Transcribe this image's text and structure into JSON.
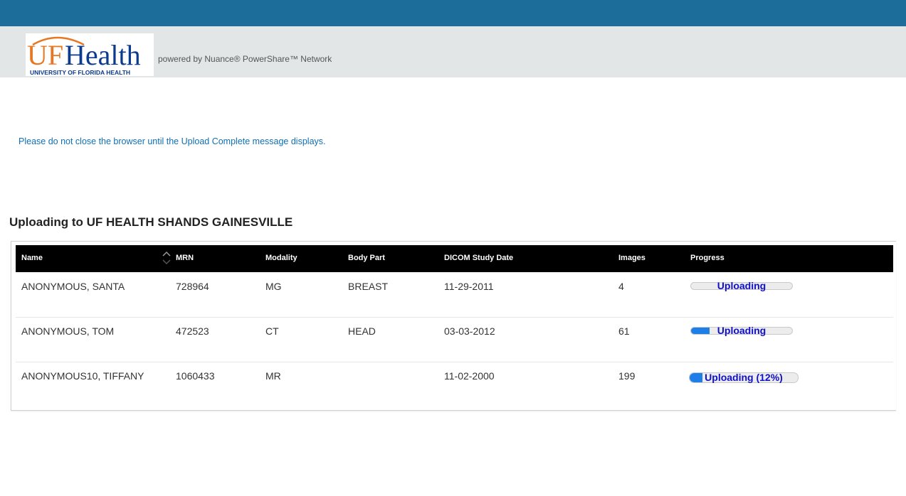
{
  "header": {
    "logo_text": "UFHealth",
    "logo_subtext": "UNIVERSITY OF FLORIDA HEALTH",
    "powered_by": "powered by Nuance® PowerShare™ Network"
  },
  "notice": "Please do not close the browser until the Upload Complete message displays.",
  "upload": {
    "prefix": "Uploading to ",
    "destination": "UF HEALTH SHANDS GAINESVILLE"
  },
  "table": {
    "columns": [
      "Name",
      "MRN",
      "Modality",
      "Body Part",
      "DICOM Study Date",
      "Images",
      "Progress"
    ],
    "rows": [
      {
        "name": "ANONYMOUS, SANTA",
        "mrn": "728964",
        "modality": "MG",
        "body_part": "BREAST",
        "date": "11-29-2011",
        "images": "4",
        "progress_label": "Uploading",
        "progress_fraction": 0.0
      },
      {
        "name": "ANONYMOUS, TOM",
        "mrn": "472523",
        "modality": "CT",
        "body_part": "HEAD",
        "date": "03-03-2012",
        "images": "61",
        "progress_label": "Uploading",
        "progress_fraction": 0.18
      },
      {
        "name": "ANONYMOUS10, TIFFANY",
        "mrn": "1060433",
        "modality": "MR",
        "body_part": "",
        "date": "11-02-2000",
        "images": "199",
        "progress_label": "Uploading (12%)",
        "progress_fraction": 0.12
      }
    ]
  },
  "colors": {
    "topbar": "#1d6d9b",
    "brandbar": "#e2e6e6",
    "logo_orange": "#e87722",
    "logo_blue": "#0b3b8f",
    "notice_text": "#0f6fb3",
    "progress_fill": "#1f7fe8",
    "progress_text": "#1010c8"
  }
}
